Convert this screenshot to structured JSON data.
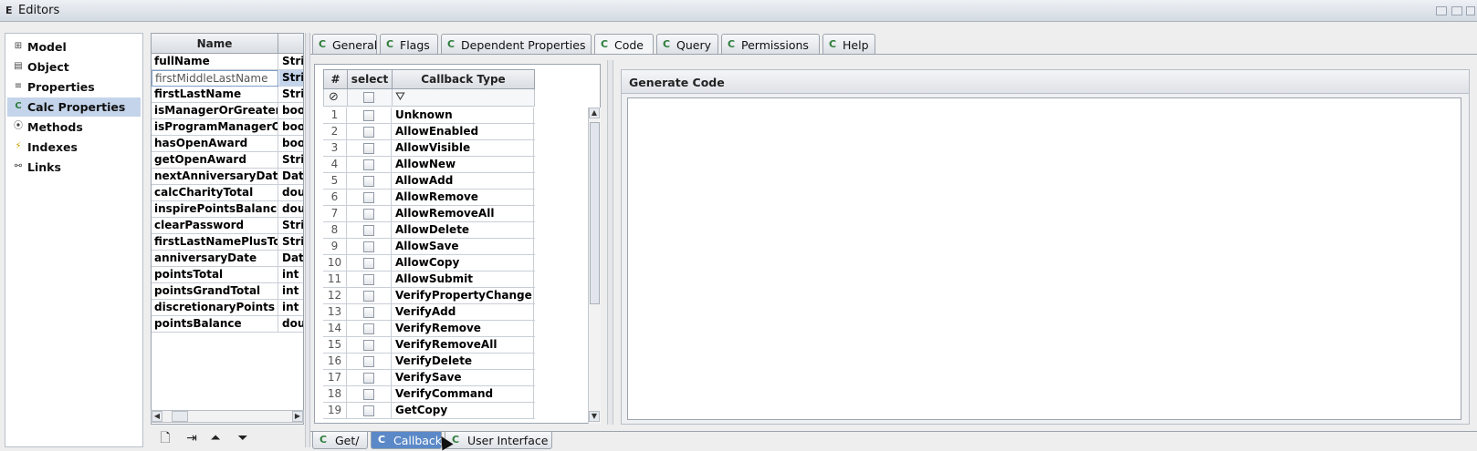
{
  "window": {
    "title": "Editors"
  },
  "nav": {
    "items": [
      {
        "label": "Model",
        "icon": "model-icon",
        "selected": false
      },
      {
        "label": "Object",
        "icon": "object-icon",
        "selected": false
      },
      {
        "label": "Properties",
        "icon": "properties-icon",
        "selected": false
      },
      {
        "label": "Calc Properties",
        "icon": "calc-properties-icon",
        "selected": true
      },
      {
        "label": "Methods",
        "icon": "methods-icon",
        "selected": false
      },
      {
        "label": "Indexes",
        "icon": "indexes-icon",
        "selected": false
      },
      {
        "label": "Links",
        "icon": "links-icon",
        "selected": false
      }
    ]
  },
  "nameTable": {
    "header": "Name",
    "rows": [
      {
        "name": "fullName",
        "type": "Stri"
      },
      {
        "name": "firstMiddleLastName",
        "type": "Stri",
        "editing": true
      },
      {
        "name": "firstLastName",
        "type": "Stri"
      },
      {
        "name": "isManagerOrGreater",
        "type": "boo"
      },
      {
        "name": "isProgramManagerOr...",
        "type": "boo"
      },
      {
        "name": "hasOpenAward",
        "type": "boo"
      },
      {
        "name": "getOpenAward",
        "type": "Stri"
      },
      {
        "name": "nextAnniversaryDate",
        "type": "Date"
      },
      {
        "name": "calcCharityTotal",
        "type": "dou"
      },
      {
        "name": "inspirePointsBalance",
        "type": "dou"
      },
      {
        "name": "clearPassword",
        "type": "Stri"
      },
      {
        "name": "firstLastNamePlusTo...",
        "type": "Stri"
      },
      {
        "name": "anniversaryDate",
        "type": "Date"
      },
      {
        "name": "pointsTotal",
        "type": "int"
      },
      {
        "name": "pointsGrandTotal",
        "type": "int"
      },
      {
        "name": "discretionaryPoints",
        "type": "int"
      },
      {
        "name": "pointsBalance",
        "type": "dou"
      }
    ]
  },
  "topTabs": [
    {
      "label": "General",
      "active": false
    },
    {
      "label": "Flags",
      "active": false
    },
    {
      "label": "Dependent Properties",
      "active": false
    },
    {
      "label": "Code",
      "active": true
    },
    {
      "label": "Query",
      "active": false
    },
    {
      "label": "Permissions",
      "active": false
    },
    {
      "label": "Help",
      "active": false
    }
  ],
  "callbackTable": {
    "headers": {
      "num": "#",
      "select": "select",
      "type": "Callback Type"
    },
    "rows": [
      {
        "num": "1",
        "type": "Unknown"
      },
      {
        "num": "2",
        "type": "AllowEnabled"
      },
      {
        "num": "3",
        "type": "AllowVisible"
      },
      {
        "num": "4",
        "type": "AllowNew"
      },
      {
        "num": "5",
        "type": "AllowAdd"
      },
      {
        "num": "6",
        "type": "AllowRemove"
      },
      {
        "num": "7",
        "type": "AllowRemoveAll"
      },
      {
        "num": "8",
        "type": "AllowDelete"
      },
      {
        "num": "9",
        "type": "AllowSave"
      },
      {
        "num": "10",
        "type": "AllowCopy"
      },
      {
        "num": "11",
        "type": "AllowSubmit"
      },
      {
        "num": "12",
        "type": "VerifyPropertyChange"
      },
      {
        "num": "13",
        "type": "VerifyAdd"
      },
      {
        "num": "14",
        "type": "VerifyRemove"
      },
      {
        "num": "15",
        "type": "VerifyRemoveAll"
      },
      {
        "num": "16",
        "type": "VerifyDelete"
      },
      {
        "num": "17",
        "type": "VerifySave"
      },
      {
        "num": "18",
        "type": "VerifyCommand"
      },
      {
        "num": "19",
        "type": "GetCopy"
      }
    ]
  },
  "generateCode": {
    "title": "Generate Code"
  },
  "bottomTabs": [
    {
      "label": "Get/",
      "active": false
    },
    {
      "label": "Callback",
      "active": true
    },
    {
      "label": "User Interface",
      "active": false
    }
  ],
  "colors": {
    "accent": "#5b89c8",
    "selection": "#c4d4ea",
    "tabIcon": "#2d7d3a"
  }
}
